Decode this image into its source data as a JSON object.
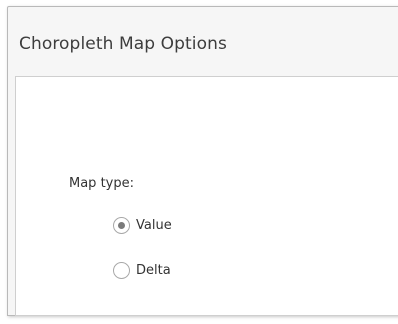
{
  "dialog": {
    "title": "Choropleth Map Options"
  },
  "map_type": {
    "label": "Map type:",
    "selected": "Value",
    "options": [
      {
        "label": "Value",
        "checked": true
      },
      {
        "label": "Delta",
        "checked": false
      }
    ]
  }
}
